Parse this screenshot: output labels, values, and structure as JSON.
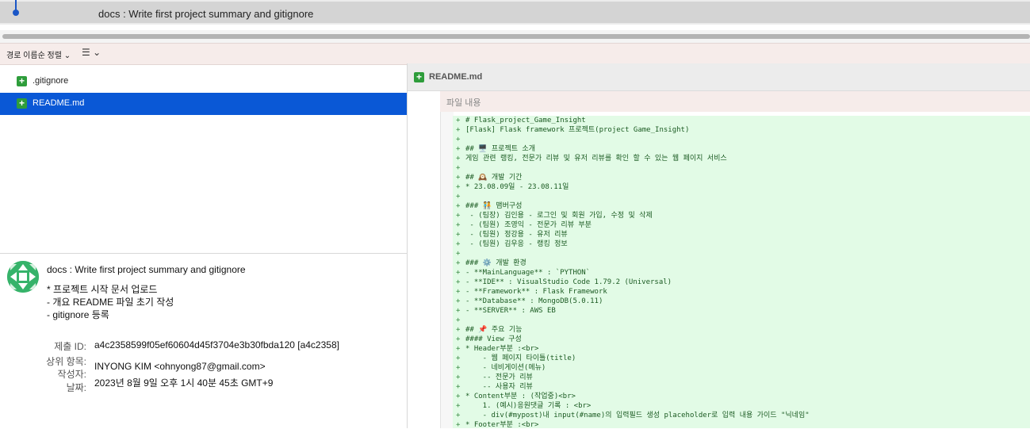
{
  "commit_header": {
    "subject": "docs : Write first project summary and gitignore"
  },
  "sort_bar": {
    "sort_label": "경로 이름순 정렬 ⌄",
    "list_label": "☰ ⌄"
  },
  "files": [
    {
      "name": ".gitignore",
      "selected": false
    },
    {
      "name": "README.md",
      "selected": true
    }
  ],
  "commit_info": {
    "subject": "docs : Write first project summary and gitignore",
    "body": [
      "* 프로젝트 시작 문서 업로드",
      "- 개요 README 파일 초기 작성",
      "- gitignore 등록"
    ],
    "labels": {
      "commit_id": "제출 ID:",
      "parents": "상위 항목:",
      "author": "작성자:",
      "date": "날짜:"
    },
    "commit_id": "a4c2358599f05ef60604d45f3704e3b30fbda120 [a4c2358]",
    "author": "INYONG KIM <ohnyong87@gmail.com>",
    "date": "2023년 8월 9일 오후 1시 40분 45초 GMT+9"
  },
  "diff": {
    "file_name": "README.md",
    "content_label": "파일 내용",
    "lines": [
      "# Flask_project_Game_Insight",
      "[Flask] Flask framework 프로젝트(project Game_Insight)",
      "",
      "## 🖥️ 프로젝트 소개",
      "게임 관련 랭킹, 전문가 리뷰 및 유저 리뷰를 확인 할 수 있는 웹 페이지 서비스",
      "",
      "## 🕰️ 개발 기간",
      "* 23.08.09일 - 23.08.11일",
      "",
      "### 🧑‍🤝‍🧑 맴버구성",
      " - (팀장) 김인용 - 로그인 및 회원 가입, 수정 및 삭제",
      " - (팀원) 조영익 - 전문가 리뷰 부분",
      " - (팀원) 정강용 - 유저 리뷰",
      " - (팀원) 김우응 - 랭킹 정보",
      "",
      "### ⚙️ 개발 환경",
      "- **MainLanguage** : `PYTHON`",
      "- **IDE** : VisualStudio Code 1.79.2 (Universal)",
      "- **Framework** : Flask Framework",
      "- **Database** : MongoDB(5.0.11)",
      "- **SERVER** : AWS EB",
      "",
      "## 📌 주요 기능",
      "#### View 구성",
      "* Header부분 :<br>",
      "    - 웹 페이지 타이틀(title)",
      "    - 네비게이션(메뉴)",
      "    -- 전문가 리뷰",
      "    -- 사용자 리뷰",
      "* Content부분 : (작업중)<br>",
      "    1. (예시)응원댓글 기록 : <br>",
      "    - div(#mypost)내 input(#name)의 입력필드 생성 placeholder로 입력 내용 가이드 \"닉네임\"",
      "* Footer부분 :<br>"
    ]
  }
}
